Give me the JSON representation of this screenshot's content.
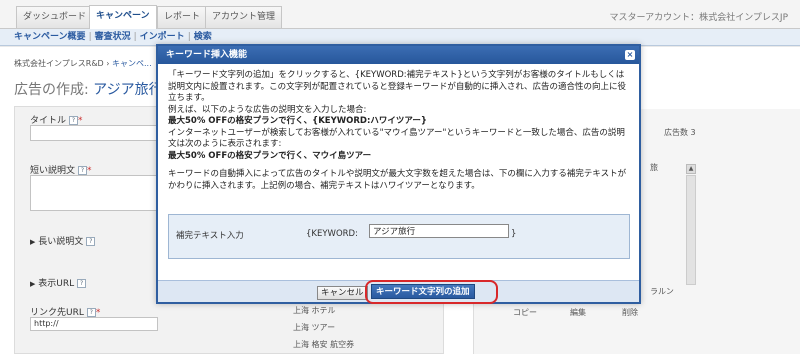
{
  "tabs": [
    {
      "label": "ダッシュボード",
      "active": false
    },
    {
      "label": "キャンペーン",
      "active": true
    },
    {
      "label": "レポート",
      "active": false
    },
    {
      "label": "アカウント管理",
      "active": false
    }
  ],
  "account_label": "マスターアカウント：株式会社インプレスJP",
  "subnav": {
    "items": [
      "キャンペーン概要",
      "審査状況",
      "インポート",
      "検索"
    ]
  },
  "breadcrumb": {
    "first": "株式会社インプレスR&D",
    "second": "キャンペ..."
  },
  "page_title": {
    "prefix": "広告の作成:",
    "name": "アジア旅行"
  },
  "form": {
    "title_label": "タイトル",
    "short_desc_label": "短い説明文",
    "long_desc_label": "長い説明文",
    "display_url_label": "表示URL",
    "link_url_label": "リンク先URL",
    "link_url_value": "http://",
    "help_glyph": "?",
    "required_mark": "*",
    "expand_glyph": "▶"
  },
  "keyword_list": [
    "上海 ツアー",
    "上海 格安 航空券"
  ],
  "keyword_list_top": "上海 ホテル",
  "ad_count_label": "広告数 3",
  "row_actions": [
    "コピー",
    "編集",
    "削除"
  ],
  "peek_texts": [
    "旅",
    "ラルン"
  ],
  "modal": {
    "title": "キーワード挿入機能",
    "close_glyph": "×",
    "para1": "「キーワード文字列の追加」をクリックすると、{KEYWORD:補完テキスト}という文字列がお客様のタイトルもしくは説明文内に設置されます。この文字列が配置されていると登録キーワードが自動的に挿入され、広告の適合性の向上に役立ちます。",
    "para2": "例えば、以下のような広告の説明文を入力した場合:",
    "para3": "最大50% OFFの格安プランで行く、{KEYWORD:ハワイツアー}",
    "para4": "インターネットユーザーが検索してお客様が入れている\"マウイ島ツアー\"というキーワードと一致した場合、広告の説明文は次のように表示されます:",
    "para5": "最大50% OFFの格安プランで行く、マウイ島ツアー",
    "para6": "キーワードの自動挿入によって広告のタイトルや説明文が最大文字数を超えた場合は、下の欄に入力する補完テキストがかわりに挿入されます。上記例の場合、補完テキストはハワイツアーとなります。",
    "field_label": "補完テキスト入力",
    "keyword_prefix": "{KEYWORD:",
    "keyword_suffix": "}",
    "field_value": "アジア旅行",
    "cancel_label": "キャンセル",
    "add_label": "キーワード文字列の追加"
  },
  "colors": {
    "modal_header": "#2f5ea0",
    "highlight_ring": "#d8282a",
    "link": "#2a5aa0"
  }
}
